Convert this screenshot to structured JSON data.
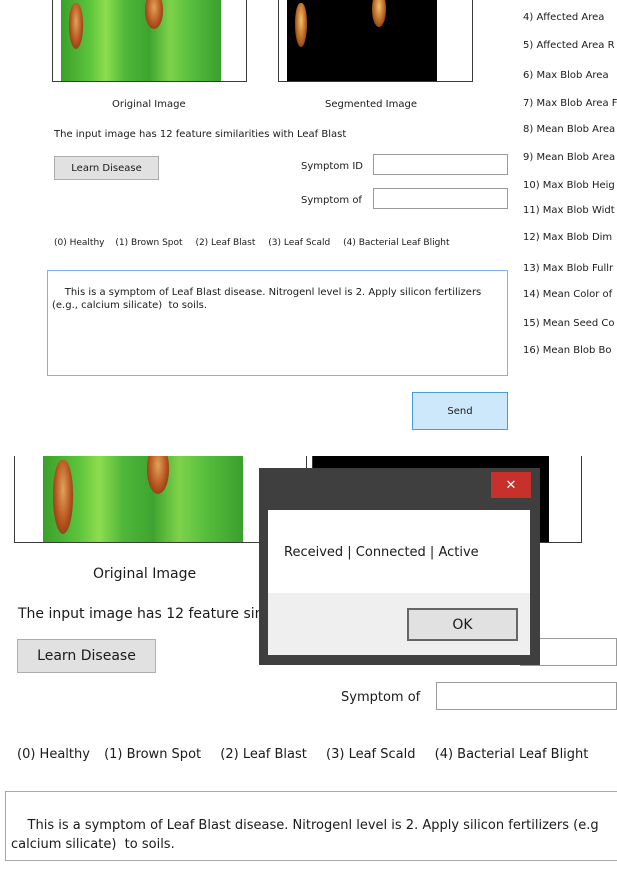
{
  "top": {
    "original_label": "Original Image",
    "segmented_label": "Segmented Image",
    "similarity_text": "The input image has 12 feature similarities with Leaf Blast",
    "learn_button": "Learn Disease",
    "symptom_id_label": "Symptom ID",
    "symptom_of_label": "Symptom of",
    "symptom_id_value": "",
    "symptom_of_value": "",
    "classes": [
      "(0) Healthy",
      "(1) Brown Spot",
      "(2) Leaf Blast",
      "(3) Leaf Scald",
      "(4) Bacterial Leaf Blight"
    ],
    "message": "This is a symptom of Leaf Blast disease. Nitrogenl level is 2. Apply silicon fertilizers (e.g., calcium silicate)  to soils.",
    "send_button": "Send",
    "features": [
      "4) Affected Area",
      "5) Affected Area R",
      "6) Max Blob Area",
      "7) Max Blob Area F",
      "8) Mean Blob Area",
      "9) Mean Blob Area",
      "10) Max Blob Heig",
      "11) Max Blob Widt",
      "12) Max Blob Dim",
      "13) Max Blob Fullr",
      "14) Mean Color of",
      "15) Mean Seed Co",
      "16) Mean Blob Bo"
    ]
  },
  "bottom": {
    "original_label": "Original Image",
    "similarity_text": "The input image has 12 feature simila",
    "learn_button": "Learn Disease",
    "symptom_of_label": "Symptom of",
    "classes": [
      "(0) Healthy",
      "(1) Brown Spot",
      "(2) Leaf Blast",
      "(3) Leaf Scald",
      "(4) Bacterial Leaf Blight"
    ],
    "message": "This is a symptom of Leaf Blast disease. Nitrogenl level is 2. Apply silicon fertilizers (e.g\ncalcium silicate)  to soils.",
    "dialog": {
      "close_glyph": "✕",
      "message": "Received | Connected | Active",
      "ok_button": "OK"
    }
  }
}
